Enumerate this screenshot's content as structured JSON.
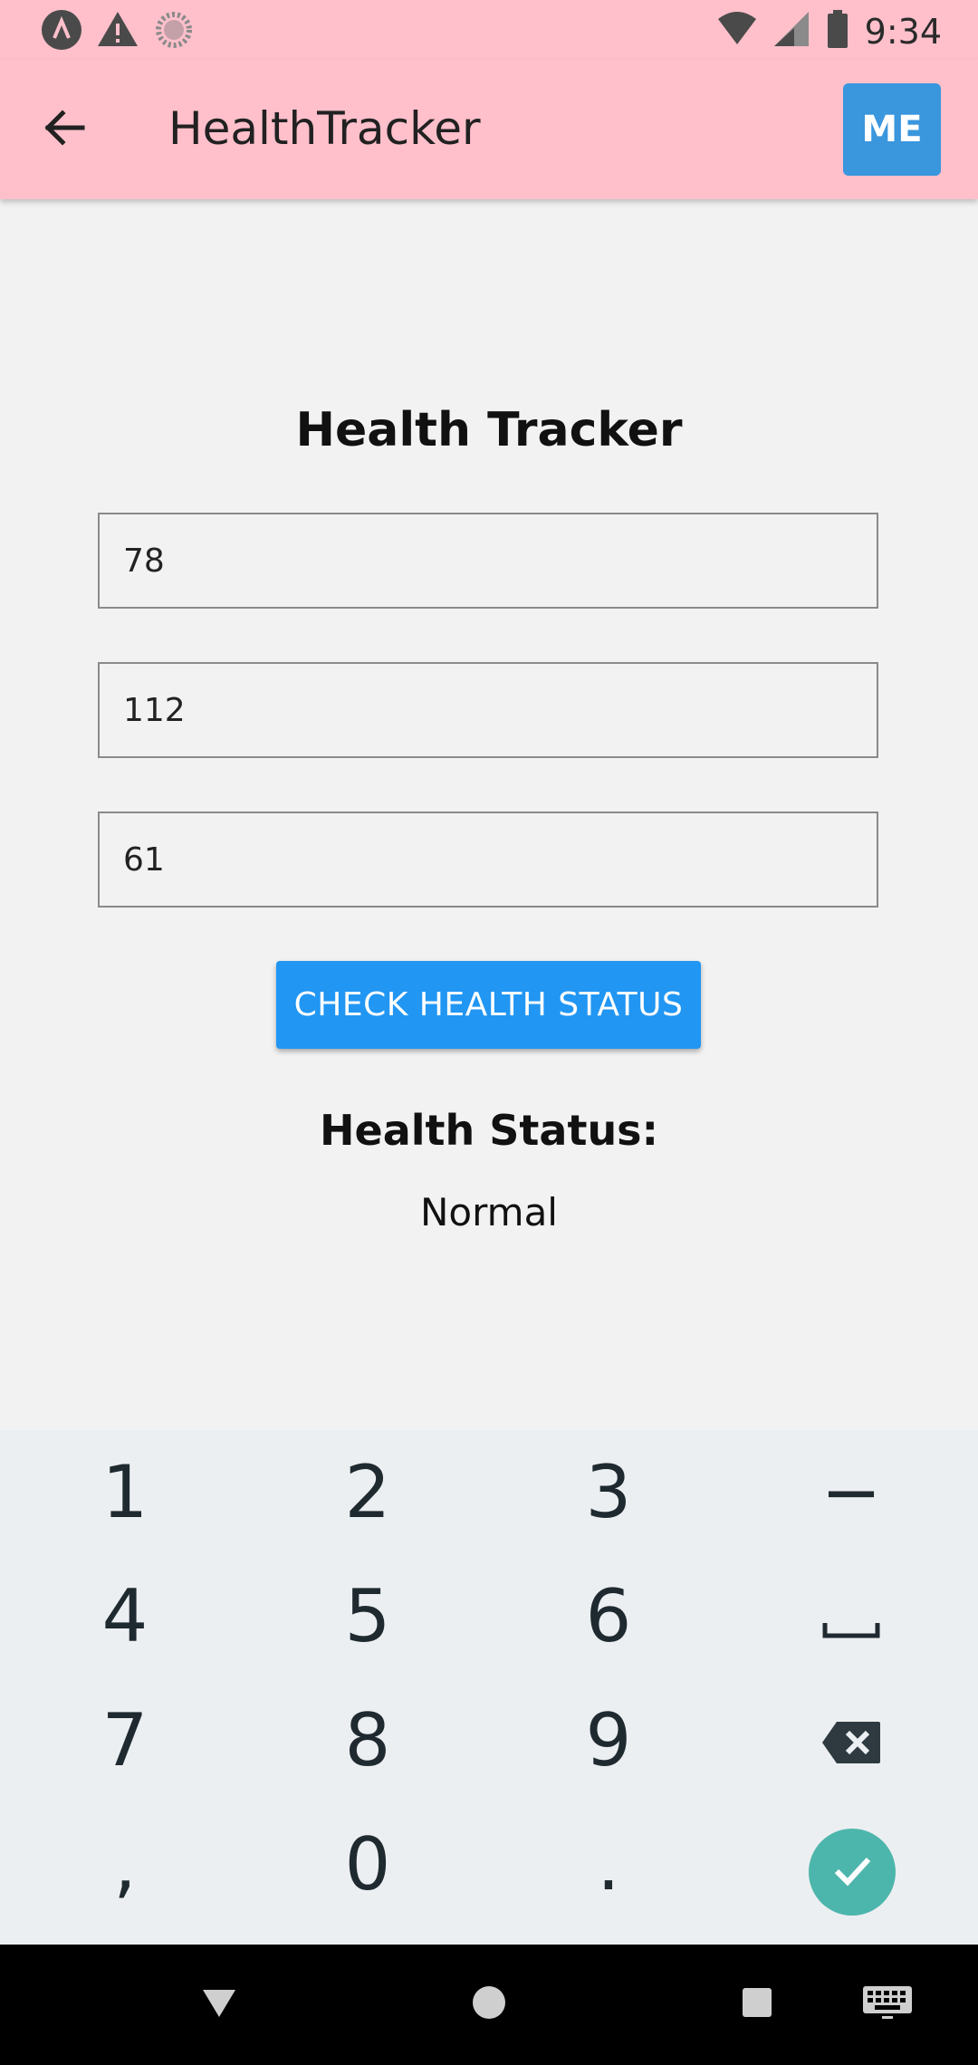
{
  "status_bar": {
    "time": "9:34",
    "icons": [
      "app-notification-icon",
      "warning-icon",
      "sync-icon",
      "wifi-icon",
      "cellular-signal-icon",
      "battery-icon"
    ]
  },
  "app_bar": {
    "title": "HealthTracker",
    "back_icon": "arrow-back-icon",
    "profile_button_label": "ME",
    "profile_button_color": "#3a96dd",
    "background_color": "#ffc0cb"
  },
  "main": {
    "heading": "Health Tracker",
    "fields": [
      {
        "value": "78"
      },
      {
        "value": "112"
      },
      {
        "value": "61"
      }
    ],
    "check_button_label": "CHECK HEALTH STATUS",
    "check_button_color": "#2196f3",
    "status_heading": "Health Status:",
    "status_value": "Normal"
  },
  "keyboard": {
    "rows": [
      [
        "1",
        "2",
        "3",
        "−"
      ],
      [
        "4",
        "5",
        "6",
        "␣"
      ],
      [
        "7",
        "8",
        "9",
        "backspace-icon"
      ],
      [
        ",",
        "0",
        ".",
        "done-icon"
      ]
    ],
    "done_color": "#4db6ac"
  },
  "nav_bar": {
    "buttons": [
      "back-triangle-icon",
      "home-circle-icon",
      "recents-square-icon",
      "keyboard-icon"
    ]
  }
}
